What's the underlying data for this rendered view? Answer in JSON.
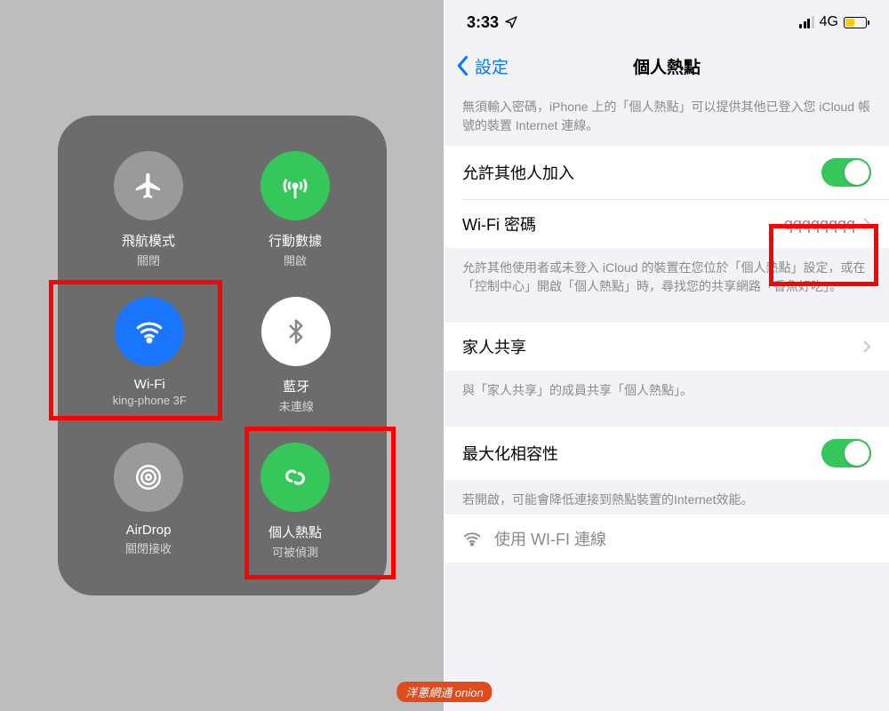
{
  "control_center": {
    "airplane": {
      "label": "飛航模式",
      "sub": "關閉"
    },
    "cellular": {
      "label": "行動數據",
      "sub": "開啟"
    },
    "wifi": {
      "label": "Wi-Fi",
      "sub": "king-phone 3F"
    },
    "bluetooth": {
      "label": "藍牙",
      "sub": "未連線"
    },
    "airdrop": {
      "label": "AirDrop",
      "sub": "關閉接收"
    },
    "hotspot": {
      "label": "個人熱點",
      "sub": "可被偵測"
    }
  },
  "statusbar": {
    "time": "3:33",
    "network": "4G"
  },
  "nav": {
    "back": "設定",
    "title": "個人熱點"
  },
  "desc1": "無須輸入密碼，iPhone 上的「個人熱點」可以提供其他已登入您 iCloud 帳號的裝置 Internet 連線。",
  "row_allow": "允許其他人加入",
  "row_pwd_label": "Wi-Fi 密碼",
  "row_pwd_value": "qqqqqqqq",
  "desc2": "允許其他使用者或未登入 iCloud 的裝置在您位於「個人熱點」設定，或在「控制中心」開啟「個人熱點」時，尋找您的共享網路「香魚好吃」。",
  "row_family": "家人共享",
  "desc3": "與「家人共享」的成員共享「個人熱點」。",
  "row_compat": "最大化相容性",
  "desc4": "若開啟，可能會降低連接到熱點裝置的Internet效能。",
  "row_wifi": "使用 WI-FI 連線",
  "watermark": "洋蔥網通 onion"
}
